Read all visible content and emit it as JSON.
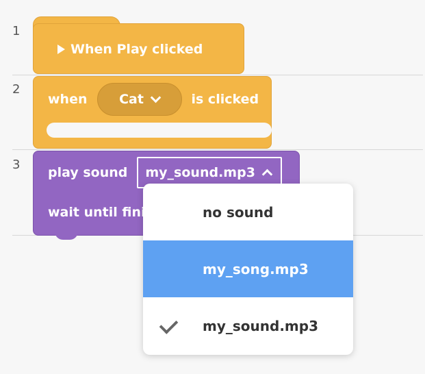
{
  "editor": {
    "line_numbers": [
      "1",
      "2",
      "3"
    ]
  },
  "blocks": {
    "hat": {
      "label": "When Play clicked"
    },
    "when_clicked": {
      "prefix": "when",
      "dropdown_value": "Cat",
      "suffix": "is clicked"
    },
    "play_sound": {
      "label": "play sound",
      "dropdown_value": "my_sound.mp3",
      "wait_label": "wait until fini"
    }
  },
  "dropdown_menu": {
    "items": [
      {
        "label": "no sound",
        "selected": false,
        "checked": false
      },
      {
        "label": "my_song.mp3",
        "selected": true,
        "checked": false
      },
      {
        "label": "my_sound.mp3",
        "selected": false,
        "checked": true
      }
    ]
  },
  "colors": {
    "event_block": "#f3b646",
    "sound_block": "#9266c2",
    "menu_highlight": "#5ea1f2"
  }
}
